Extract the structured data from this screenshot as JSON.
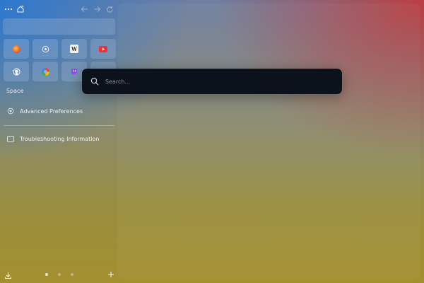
{
  "sidebar": {
    "toolbar": {
      "menu_icon": "ellipsis-icon",
      "home_icon": "home-icon",
      "back_icon": "back-arrow-icon",
      "forward_icon": "forward-arrow-icon",
      "reload_icon": "reload-icon"
    },
    "pinned_sites": [
      {
        "icon": "firefox-icon"
      },
      {
        "icon": "generic-site-icon"
      },
      {
        "icon": "wikipedia-icon",
        "glyph": "W"
      },
      {
        "icon": "youtube-icon"
      },
      {
        "icon": "github-icon"
      },
      {
        "icon": "google-icon"
      },
      {
        "icon": "twitch-icon"
      },
      {
        "icon": "empty-tile"
      }
    ],
    "space_label": "Space",
    "items": [
      {
        "label": "Advanced Preferences",
        "icon": "gear-icon"
      },
      {
        "label": "Troubleshooting Information",
        "icon": "window-icon"
      }
    ],
    "bottom": {
      "download_icon": "download-icon",
      "workspace_dots": 3,
      "active_workspace": 1,
      "add_icon": "plus-icon"
    }
  },
  "search": {
    "placeholder": "Search...",
    "value": ""
  },
  "colors": {
    "search_bg": "#0b121c",
    "accent_blue": "#2878d2",
    "accent_red": "#be3c3c",
    "accent_olive": "#a38f2e"
  }
}
